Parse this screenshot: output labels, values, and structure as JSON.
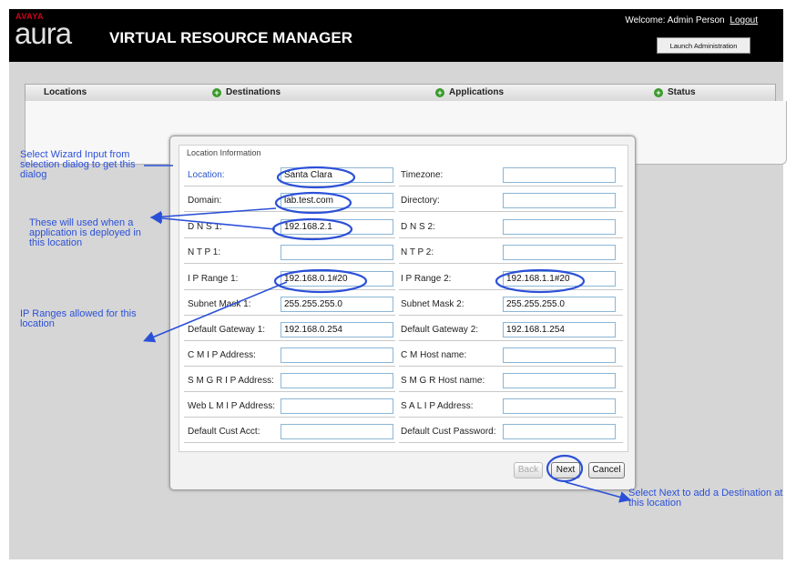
{
  "brand": {
    "company": "AVAYA",
    "product": "aura"
  },
  "header": {
    "title": "VIRTUAL RESOURCE MANAGER",
    "welcome": "Welcome: Admin Person",
    "logout": "Logout",
    "launch_button": "Launch Administration"
  },
  "nav": {
    "locations": "Locations",
    "destinations": "Destinations",
    "applications": "Applications",
    "status": "Status"
  },
  "dialog": {
    "legend": "Location Information",
    "fields": {
      "location": {
        "label": "Location:",
        "value": "Santa Clara"
      },
      "timezone": {
        "label": "Timezone:",
        "value": ""
      },
      "domain": {
        "label": "Domain:",
        "value": "lab.test.com"
      },
      "directory": {
        "label": "Directory:",
        "value": ""
      },
      "dns1": {
        "label": "D N S 1:",
        "value": "192.168.2.1"
      },
      "dns2": {
        "label": "D N S 2:",
        "value": ""
      },
      "ntp1": {
        "label": "N T P 1:",
        "value": ""
      },
      "ntp2": {
        "label": "N T P 2:",
        "value": ""
      },
      "iprange1": {
        "label": "I P Range 1:",
        "value": "192.168.0.1#20"
      },
      "iprange2": {
        "label": "I P Range 2:",
        "value": "192.168.1.1#20"
      },
      "subnet1": {
        "label": "Subnet Mask 1:",
        "value": "255.255.255.0"
      },
      "subnet2": {
        "label": "Subnet Mask 2:",
        "value": "255.255.255.0"
      },
      "gateway1": {
        "label": "Default Gateway 1:",
        "value": "192.168.0.254"
      },
      "gateway2": {
        "label": "Default Gateway 2:",
        "value": "192.168.1.254"
      },
      "cmip": {
        "label": "C M I P Address:",
        "value": ""
      },
      "cmhost": {
        "label": "C M Host name:",
        "value": ""
      },
      "smgrip": {
        "label": "S M G R I P Address:",
        "value": ""
      },
      "smgrhost": {
        "label": "S M G R Host name:",
        "value": ""
      },
      "weblmip": {
        "label": "Web L M I P Address:",
        "value": ""
      },
      "salip": {
        "label": "S A L I P Address:",
        "value": ""
      },
      "custacct": {
        "label": "Default Cust Acct:",
        "value": ""
      },
      "custpass": {
        "label": "Default Cust Password:",
        "value": ""
      }
    },
    "buttons": {
      "back": "Back",
      "next": "Next",
      "cancel": "Cancel"
    }
  },
  "annotations": {
    "wizard": "Select Wizard Input from selection dialog to get this dialog",
    "used": "These will used when a application is deployed in this location",
    "ipranges": "IP Ranges allowed for this location",
    "next": "Select Next to add a Destination at this location"
  },
  "colors": {
    "annotation": "#2b50d8",
    "header_bg": "#000000",
    "brand_red": "#d0021b",
    "plus_green": "#3a9a2c"
  }
}
